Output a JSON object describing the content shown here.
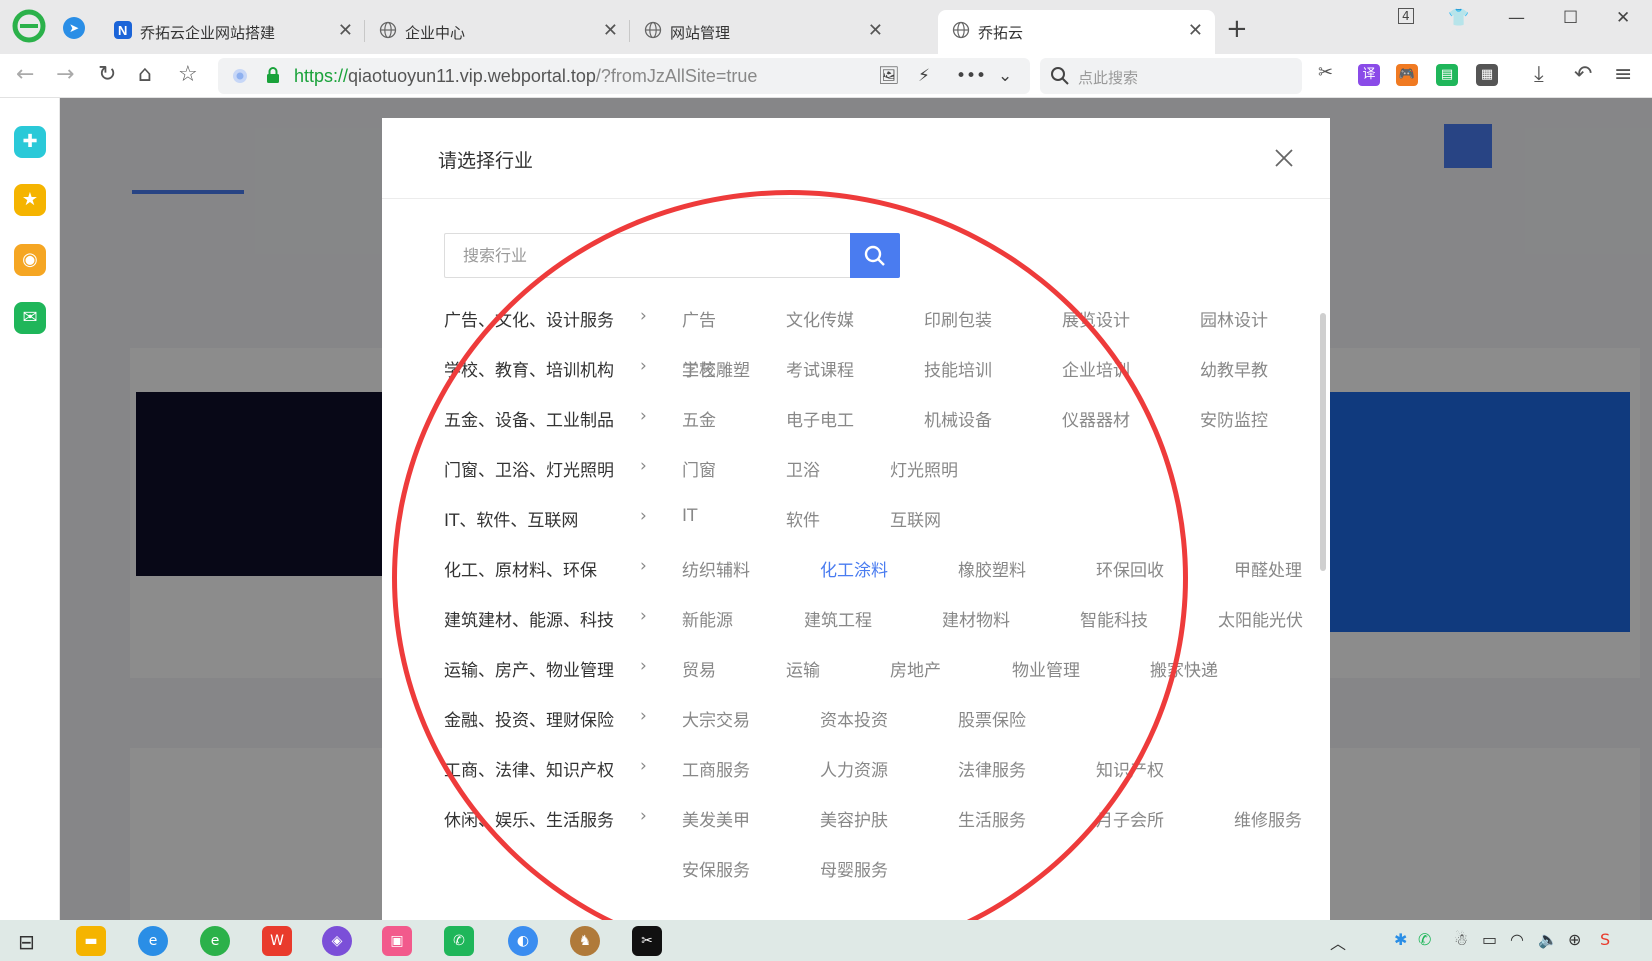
{
  "browser": {
    "tabs": [
      {
        "title": "乔拓云企业网站搭建",
        "active": false
      },
      {
        "title": "企业中心",
        "active": false
      },
      {
        "title": "网站管理",
        "active": false
      },
      {
        "title": "乔拓云",
        "active": true
      }
    ],
    "tab_count_badge": "4",
    "url": {
      "scheme": "https://",
      "host": "qiaotuoyun11.vip.webportal.top",
      "path": "/?fromJzAllSite=true"
    },
    "search_placeholder": "点此搜索",
    "ext_translate_label": "译"
  },
  "modal": {
    "title": "请选择行业",
    "search_placeholder": "搜索行业",
    "active_subcategory": "化工涂料",
    "categories": [
      {
        "name": "广告、文化、设计服务",
        "items": [
          "广告",
          "文化传媒",
          "印刷包装",
          "展览设计",
          "园林设计",
          "工艺雕塑"
        ]
      },
      {
        "name": "学校、教育、培训机构",
        "items": [
          "学校",
          "考试课程",
          "技能培训",
          "企业培训",
          "幼教早教"
        ]
      },
      {
        "name": "五金、设备、工业制品",
        "items": [
          "五金",
          "电子电工",
          "机械设备",
          "仪器器材",
          "安防监控"
        ]
      },
      {
        "name": "门窗、卫浴、灯光照明",
        "items": [
          "门窗",
          "卫浴",
          "灯光照明"
        ]
      },
      {
        "name": "IT、软件、互联网",
        "items": [
          "IT",
          "软件",
          "互联网"
        ]
      },
      {
        "name": "化工、原材料、环保",
        "items": [
          "纺织辅料",
          "化工涂料",
          "橡胶塑料",
          "环保回收",
          "甲醛处理"
        ]
      },
      {
        "name": "建筑建材、能源、科技",
        "items": [
          "新能源",
          "建筑工程",
          "建材物料",
          "智能科技",
          "太阳能光伏"
        ]
      },
      {
        "name": "运输、房产、物业管理",
        "items": [
          "贸易",
          "运输",
          "房地产",
          "物业管理",
          "搬家快递"
        ]
      },
      {
        "name": "金融、投资、理财保险",
        "items": [
          "大宗交易",
          "资本投资",
          "股票保险"
        ]
      },
      {
        "name": "工商、法律、知识产权",
        "items": [
          "工商服务",
          "人力资源",
          "法律服务",
          "知识产权"
        ]
      },
      {
        "name": "休闲、娱乐、生活服务",
        "items": [
          "美发美甲",
          "美容护肤",
          "生活服务",
          "月子会所",
          "维修服务",
          "安保服务",
          "母婴服务"
        ]
      }
    ]
  },
  "colors": {
    "accent": "#4a7cf0",
    "annotation": "#ee3b3b",
    "url_scheme": "#19a23a"
  }
}
